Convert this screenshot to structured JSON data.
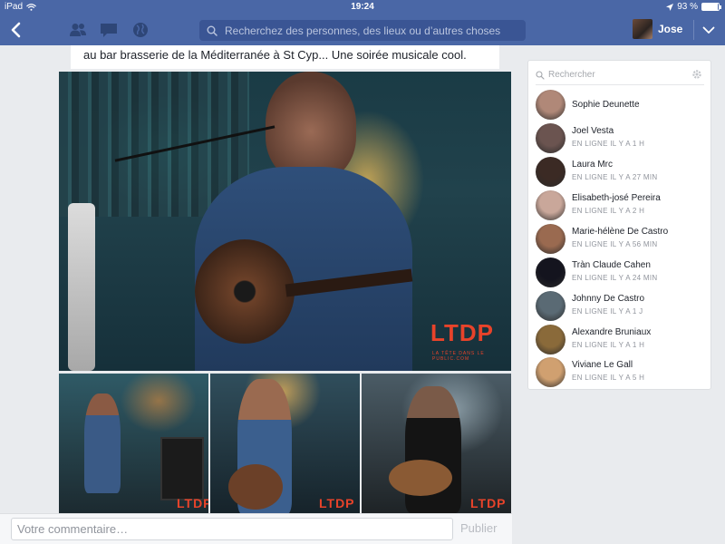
{
  "status_bar": {
    "device": "iPad",
    "time": "19:24",
    "battery": "93 %",
    "battery_level": 0.93
  },
  "nav": {
    "search_placeholder": "Recherchez des personnes, des lieux ou d’autres choses",
    "profile_name": "Jose",
    "icons": [
      "back-arrow-icon",
      "friends-icon",
      "messages-icon",
      "globe-icon",
      "search-icon",
      "chevron-down-icon"
    ]
  },
  "post": {
    "text": "au bar brasserie de la Méditerranée à St Cyp... Une soirée musicale cool.",
    "logo_text": "LTDP",
    "logo_subtext": "LA TÊTE DANS LE PUBLIC.COM"
  },
  "comment": {
    "placeholder": "Votre commentaire…",
    "publish_label": "Publier"
  },
  "chat": {
    "search_placeholder": "Rechercher",
    "contacts": [
      {
        "name": "Sophie Deunette",
        "status": "",
        "color": "#b08878"
      },
      {
        "name": "Joel Vesta",
        "status": "EN LIGNE IL Y A 1 H",
        "color": "#6b5450"
      },
      {
        "name": "Laura Mrc",
        "status": "EN LIGNE IL Y A 27 MIN",
        "color": "#3b2a24"
      },
      {
        "name": "Elisabeth-josé Pereira",
        "status": "EN LIGNE IL Y A 2 H",
        "color": "#c9a79a"
      },
      {
        "name": "Marie-hélène De Castro",
        "status": "EN LIGNE IL Y A 56 MIN",
        "color": "#9a6a50"
      },
      {
        "name": "Tràn Claude Cahen",
        "status": "EN LIGNE IL Y A 24 MIN",
        "color": "#14141e"
      },
      {
        "name": "Johnny De Castro",
        "status": "EN LIGNE IL Y A 1 J",
        "color": "#5a6a74"
      },
      {
        "name": "Alexandre Bruniaux",
        "status": "EN LIGNE IL Y A 1 H",
        "color": "#8a6a3a"
      },
      {
        "name": "Viviane Le Gall",
        "status": "EN LIGNE IL Y A 5 H",
        "color": "#d0a070"
      }
    ]
  }
}
